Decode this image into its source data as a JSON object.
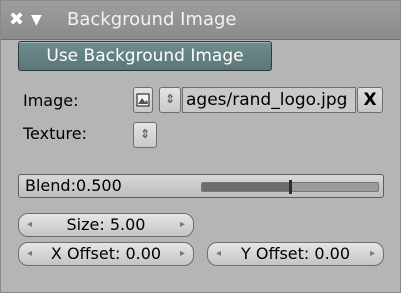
{
  "panel": {
    "title": "Background Image",
    "close_icon": "close-icon",
    "collapse_icon": "triangle-down-icon"
  },
  "use_background_button": "Use Background Image",
  "image": {
    "label": "Image:",
    "browse_icon": "image-browse-icon",
    "spinner_icon": "up-down-spinner-icon",
    "path": "ages/rand_logo.jpg",
    "clear_label": "X"
  },
  "texture": {
    "label": "Texture:",
    "spinner_icon": "up-down-spinner-icon"
  },
  "blend": {
    "label": "Blend:0.500",
    "value": 0.5
  },
  "size": {
    "label": "Size: 5.00"
  },
  "x_offset": {
    "label": "X Offset: 0.00"
  },
  "y_offset": {
    "label": "Y Offset: 0.00"
  },
  "colors": {
    "accent_button": "#5f7b7b",
    "panel_bg": "#b5b5b5",
    "titlebar_bg": "#959595"
  }
}
